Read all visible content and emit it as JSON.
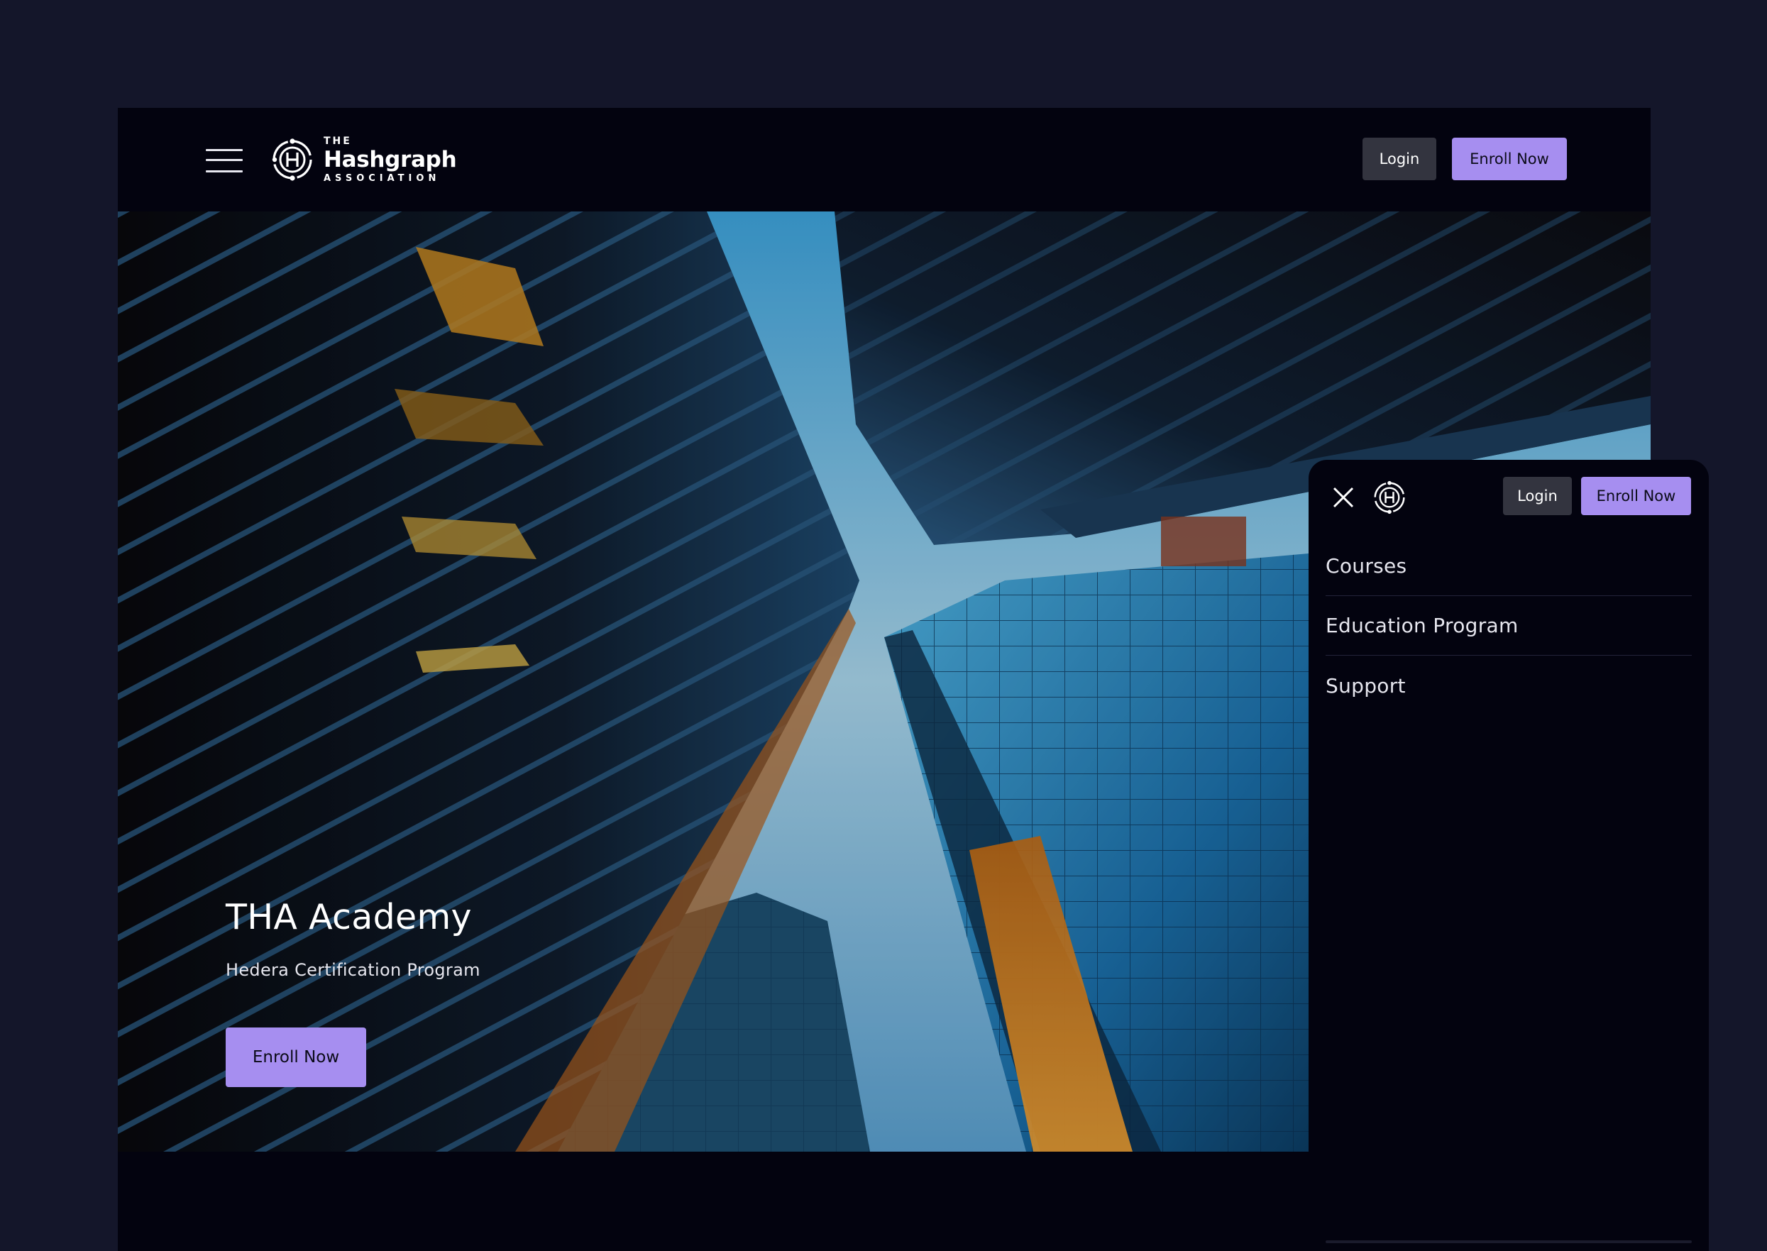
{
  "header": {
    "logo": {
      "line1": "THE",
      "line2": "Hashgraph",
      "line3": "ASSOCIATION"
    },
    "login_label": "Login",
    "enroll_label": "Enroll Now"
  },
  "hero": {
    "title": "THA Academy",
    "subtitle": "Hedera Certification Program",
    "cta_label": "Enroll Now"
  },
  "menu_panel": {
    "login_label": "Login",
    "enroll_label": "Enroll Now",
    "items": [
      {
        "label": "Courses"
      },
      {
        "label": "Education Program"
      },
      {
        "label": "Support"
      }
    ]
  },
  "colors": {
    "page_bg": "#14162a",
    "site_bg": "#03030f",
    "accent": "#a68ef0",
    "login_bg": "#33343f"
  },
  "icons": [
    "menu-icon",
    "hashgraph-logo-icon",
    "close-icon"
  ]
}
